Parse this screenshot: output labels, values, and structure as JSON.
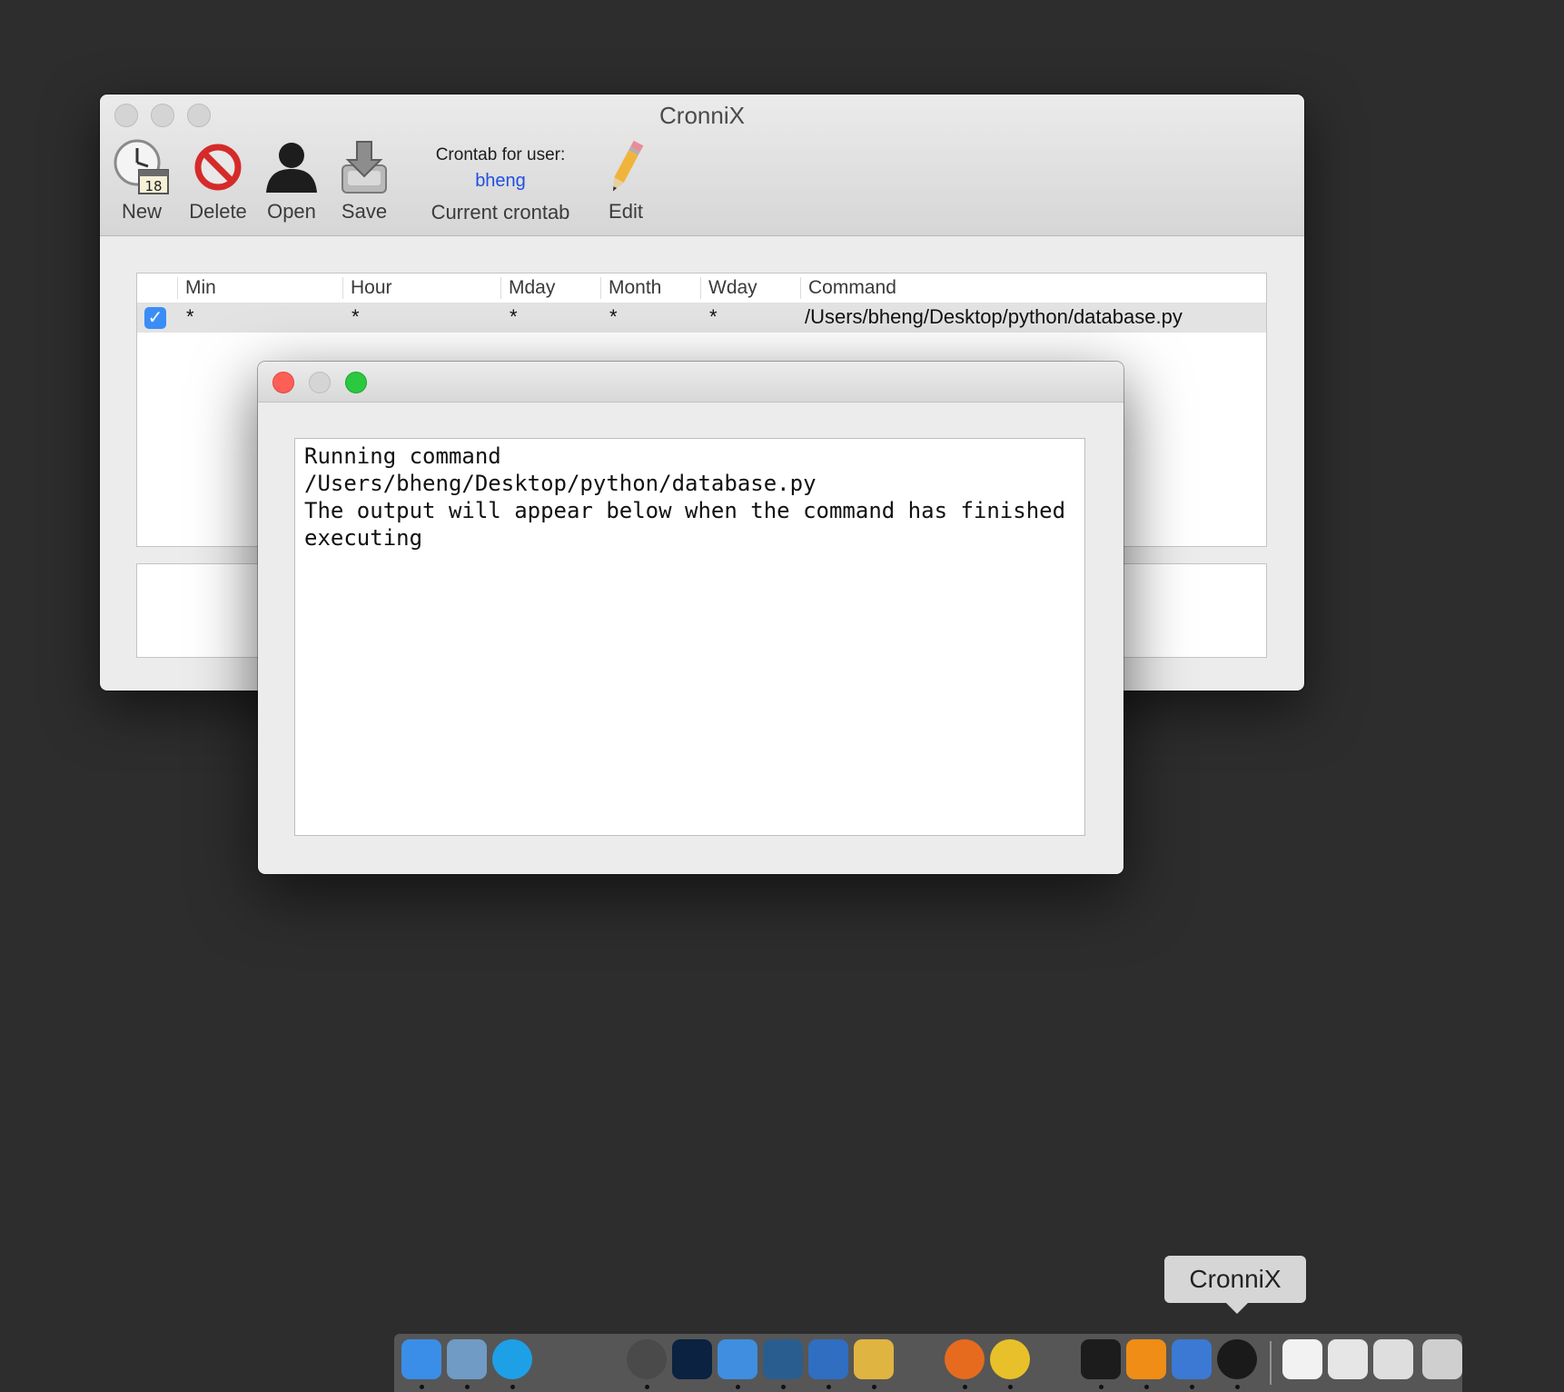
{
  "main_window": {
    "title": "CronniX",
    "toolbar": {
      "new_label": "New",
      "calendar_day": "18",
      "delete_label": "Delete",
      "open_label": "Open",
      "save_label": "Save",
      "user_caption": "Crontab for user:",
      "user_name": "bheng",
      "current_label": "Current crontab",
      "edit_label": "Edit"
    },
    "table": {
      "columns": [
        "Min",
        "Hour",
        "Mday",
        "Month",
        "Wday",
        "Command"
      ],
      "rows": [
        {
          "enabled": true,
          "min": "*",
          "hour": "*",
          "mday": "*",
          "month": "*",
          "wday": "*",
          "command": "/Users/bheng/Desktop/python/database.py"
        }
      ]
    }
  },
  "output_window": {
    "lines": [
      "Running command",
      "/Users/bheng/Desktop/python/database.py",
      "The output will appear below when the command has finished",
      "executing"
    ]
  },
  "dock": {
    "tooltip": "CronniX",
    "apps": [
      {
        "icon": "finder-icon",
        "color": "#3a8ee8"
      },
      {
        "icon": "preview-icon",
        "color": "#6f9bc4"
      },
      {
        "icon": "skype-icon",
        "color": "#1ea0e6"
      },
      {
        "icon": "alfred-icon",
        "color": "#4a4a4a"
      },
      {
        "icon": "photoshop-icon",
        "color": "#0b2240"
      },
      {
        "icon": "xcode-icon",
        "color": "#3f8ee0"
      },
      {
        "icon": "mysql-workbench-icon",
        "color": "#2a5d8f"
      },
      {
        "icon": "vmware-icon",
        "color": "#2f6ec0"
      },
      {
        "icon": "transmit-icon",
        "color": "#e0b440"
      },
      {
        "icon": "firefox-icon",
        "color": "#e66b1f"
      },
      {
        "icon": "chrome-icon",
        "color": "#e8c12a"
      },
      {
        "icon": "terminal-icon",
        "color": "#1c1c1c"
      },
      {
        "icon": "sublime-text-icon",
        "color": "#ef8d17"
      },
      {
        "icon": "system-preferences-icon",
        "color": "#3b79d4"
      },
      {
        "icon": "cronnix-icon",
        "color": "#1a1a1a"
      },
      {
        "icon": "document-stack-icon",
        "color": "#f2f2f2"
      },
      {
        "icon": "downloads-stack-icon",
        "color": "#e6e6e6"
      },
      {
        "icon": "screenshots-stack-icon",
        "color": "#dedede"
      },
      {
        "icon": "trash-icon",
        "color": "#cfcfcf"
      }
    ]
  }
}
